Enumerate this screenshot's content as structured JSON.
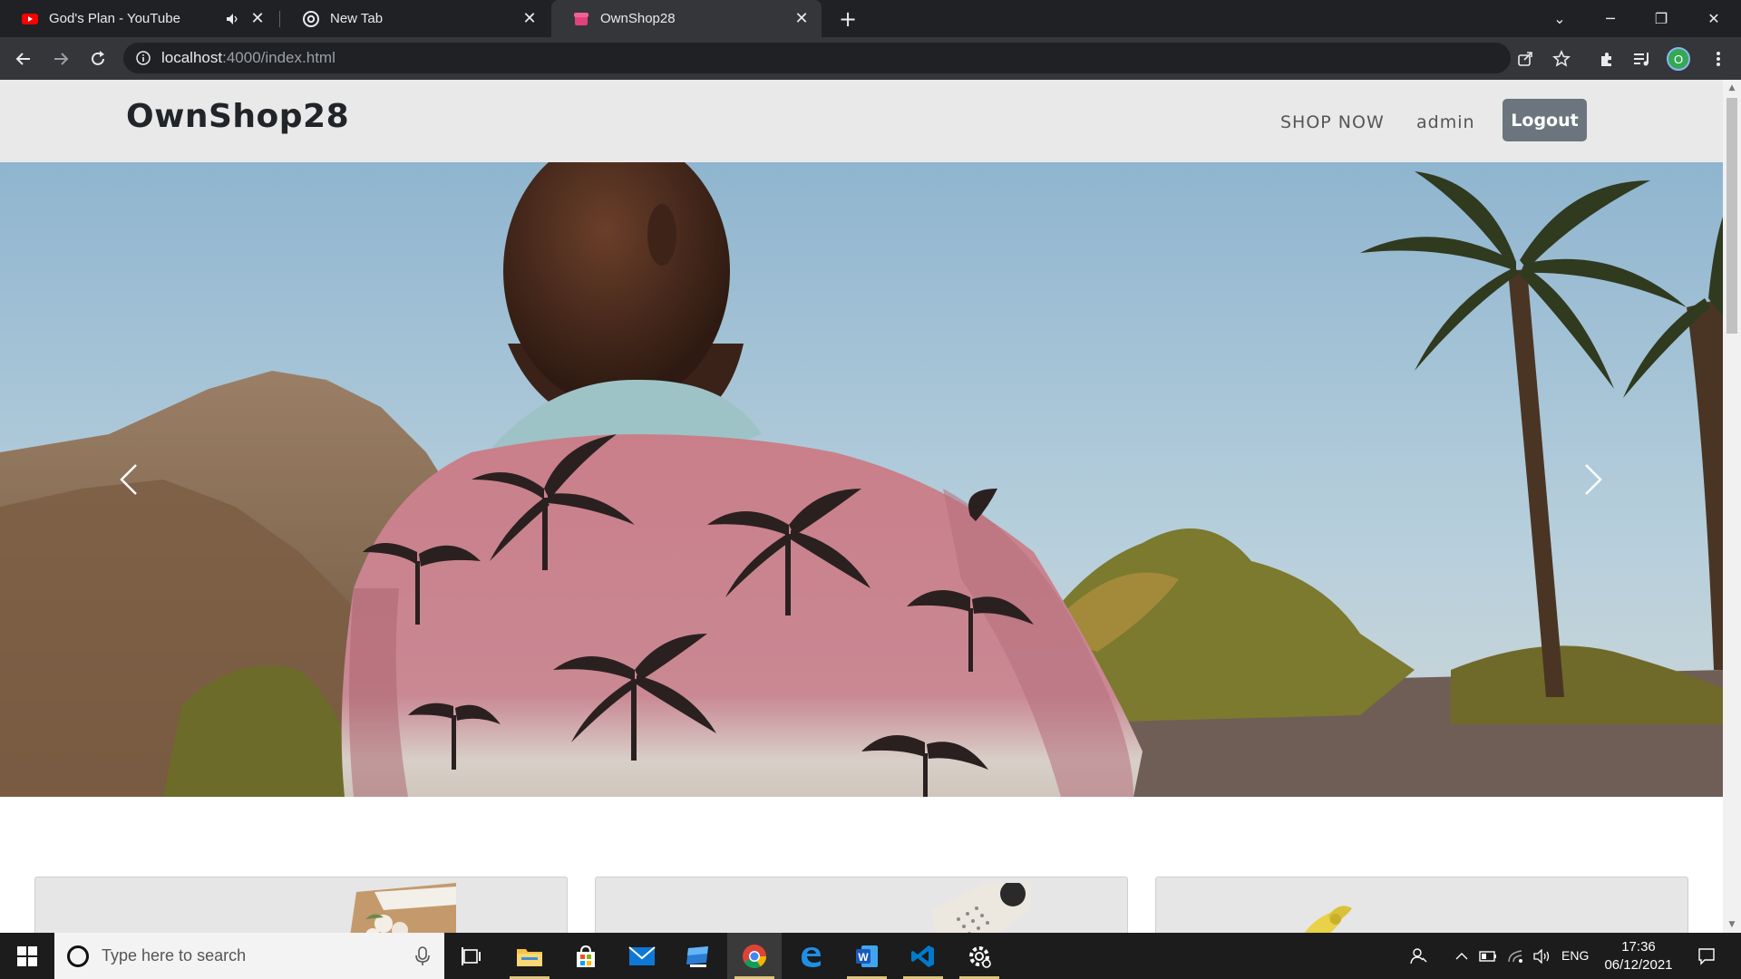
{
  "browser": {
    "tabs": [
      {
        "title": "God's Plan - YouTube",
        "favicon": "youtube-icon",
        "audio": "speaker-muted-icon",
        "active": false
      },
      {
        "title": "New Tab",
        "favicon": "chrome-icon",
        "active": false
      },
      {
        "title": "OwnShop28",
        "favicon": "shop-icon",
        "active": true
      }
    ],
    "url_host": "localhost",
    "url_rest": ":4000/index.html",
    "profile_initial": "O",
    "colors": {
      "tabstrip": "#202124",
      "toolbar": "#35363a",
      "profile": "#34a853"
    }
  },
  "site": {
    "brand": "OwnShop28",
    "nav": {
      "shop_now": "SHOP NOW",
      "user": "admin",
      "logout": "Logout"
    },
    "colors": {
      "navbar": "#e9e9e9",
      "logout_button": "#6c757d"
    },
    "carousel": {
      "prev_icon": "chevron-left-icon",
      "next_icon": "chevron-right-icon"
    },
    "cards": [
      {
        "image": "flowers-box-thumbnail"
      },
      {
        "image": "calendar-notebook-thumbnail"
      },
      {
        "image": "yellow-flower-thumbnail"
      }
    ]
  },
  "taskbar": {
    "search_placeholder": "Type here to search",
    "apps": [
      "task-view-icon",
      "file-explorer-icon",
      "store-icon",
      "mail-icon",
      "desktop-app-icon",
      "chrome-icon",
      "edge-icon",
      "word-icon",
      "vscode-icon",
      "settings-icon"
    ],
    "language": "ENG",
    "time": "17:36",
    "date": "06/12/2021"
  }
}
